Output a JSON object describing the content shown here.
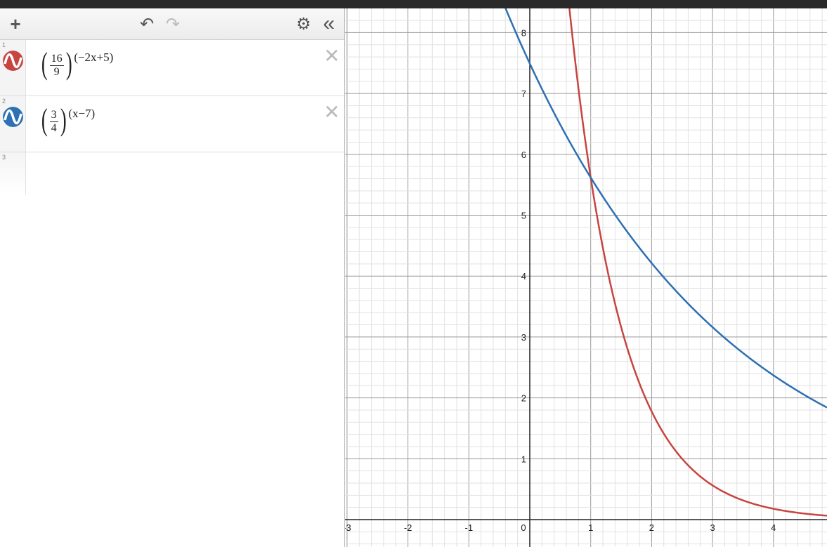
{
  "toolbar": {
    "add_label": "+",
    "undo_label": "↶",
    "redo_label": "↷",
    "settings_label": "⚙",
    "collapse_label": "«"
  },
  "expressions": [
    {
      "index": "1",
      "color": "#c74440",
      "base_num": "16",
      "base_den": "9",
      "exponent": "(−2x+5)",
      "delete_label": "✕"
    },
    {
      "index": "2",
      "color": "#2d70b3",
      "base_num": "3",
      "base_den": "4",
      "exponent": "(x−7)",
      "delete_label": "✕"
    },
    {
      "index": "3"
    }
  ],
  "graph": {
    "x_ticks": [
      "-3",
      "-2",
      "-1",
      "0",
      "1",
      "2",
      "3",
      "4"
    ],
    "y_ticks": [
      "1",
      "2",
      "3",
      "4",
      "5",
      "6",
      "7",
      "8"
    ],
    "curve_colors": [
      "#c74440",
      "#2d70b3"
    ]
  }
}
